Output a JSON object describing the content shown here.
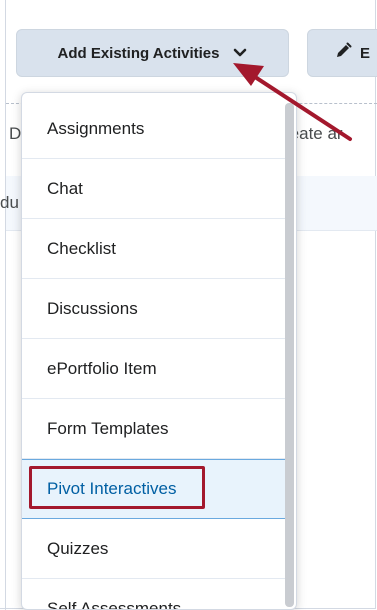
{
  "toolbar": {
    "add_existing_label": "Add Existing Activities",
    "edit_label_fragment": "E"
  },
  "background": {
    "fragment_d": "D",
    "fragment_create": "reate ar",
    "fragment_du": "du"
  },
  "menu": {
    "items": [
      {
        "label": "Assignments"
      },
      {
        "label": "Chat"
      },
      {
        "label": "Checklist"
      },
      {
        "label": "Discussions"
      },
      {
        "label": "ePortfolio Item"
      },
      {
        "label": "Form Templates"
      },
      {
        "label": "Pivot Interactives",
        "selected": true
      },
      {
        "label": "Quizzes"
      },
      {
        "label": "Self Assessments"
      }
    ]
  },
  "colors": {
    "button_bg": "#d9e2ed",
    "annotation_red": "#a3182d",
    "selected_bg": "#e8f3fc",
    "selected_text": "#005fa3"
  },
  "icons": {
    "chevron": "chevron-down-icon",
    "edit": "pencil-icon"
  }
}
